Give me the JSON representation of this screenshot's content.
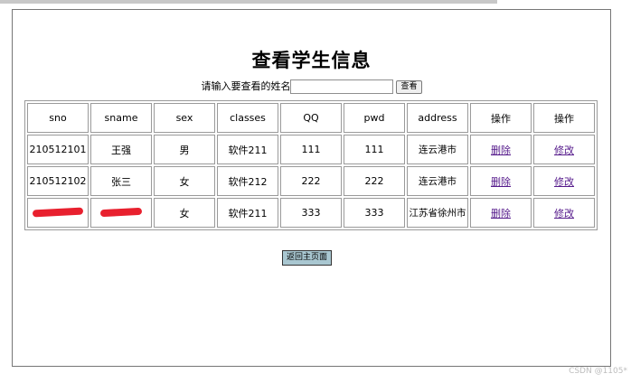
{
  "page": {
    "title": "查看学生信息",
    "search": {
      "label": "请输入要查看的姓名",
      "value": "",
      "placeholder": "",
      "button": "查看"
    },
    "back_button": "返回主页面",
    "watermark": "CSDN @1105*"
  },
  "table": {
    "headers": [
      "sno",
      "sname",
      "sex",
      "classes",
      "QQ",
      "pwd",
      "address",
      "操作",
      "操作"
    ],
    "rows": [
      {
        "sno": "210512101",
        "sname": "王强",
        "sex": "男",
        "classes": "软件211",
        "qq": "111",
        "pwd": "111",
        "address": "连云港市",
        "del": "删除",
        "edit": "修改"
      },
      {
        "sno": "210512102",
        "sname": "张三",
        "sex": "女",
        "classes": "软件212",
        "qq": "222",
        "pwd": "222",
        "address": "连云港市",
        "del": "删除",
        "edit": "修改"
      },
      {
        "sno": "",
        "sname": "",
        "sex": "女",
        "classes": "软件211",
        "qq": "333",
        "pwd": "333",
        "address": "江苏省徐州市",
        "del": "删除",
        "edit": "修改",
        "redacted": true
      }
    ]
  },
  "colors": {
    "redaction": "#e8202e",
    "link": "#551a8b",
    "back_button_bg": "#a9c7d1"
  }
}
